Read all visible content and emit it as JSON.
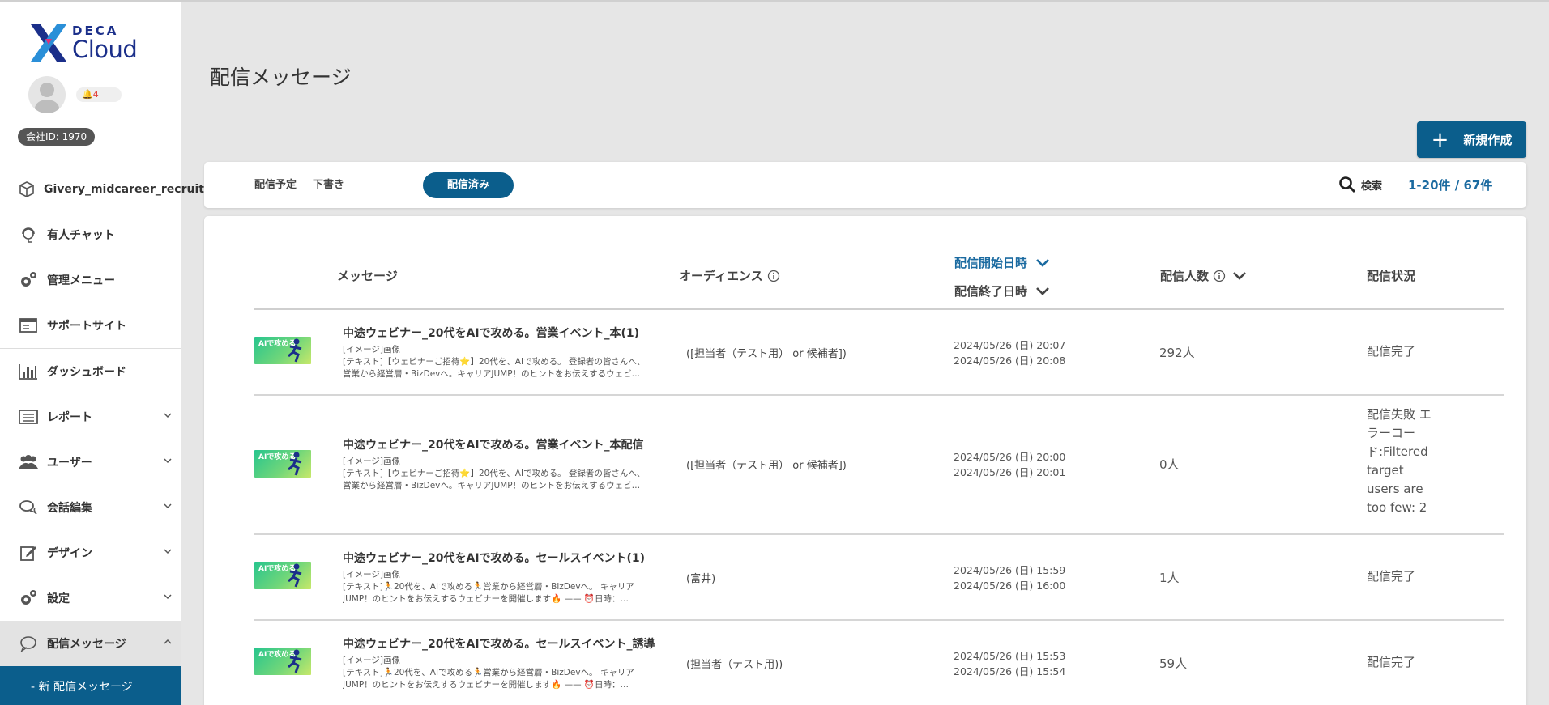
{
  "sidebar": {
    "logo_top": "DECA",
    "logo_bottom": "Cloud",
    "notification_count": "4",
    "company_id": "会社ID: 1970",
    "items": [
      {
        "label": "Givery_midcareer_recruit",
        "icon": "cube-icon"
      },
      {
        "label": "有人チャット",
        "icon": "headset-icon"
      },
      {
        "label": "管理メニュー",
        "icon": "gears-icon"
      },
      {
        "label": "サポートサイト",
        "icon": "browser-icon"
      },
      {
        "label": "ダッシュボード",
        "icon": "bar-chart-icon"
      },
      {
        "label": "レポート",
        "icon": "report-icon"
      },
      {
        "label": "ユーザー",
        "icon": "users-icon"
      },
      {
        "label": "会話編集",
        "icon": "chat-icon"
      },
      {
        "label": "デザイン",
        "icon": "edit-icon"
      },
      {
        "label": "設定",
        "icon": "gears-icon"
      },
      {
        "label": "配信メッセージ",
        "icon": "speech-bubble-icon"
      }
    ],
    "sub_item": "-  新 配信メッセージ"
  },
  "page": {
    "title": "配信メッセージ",
    "new_button": "新規作成"
  },
  "tabs": [
    {
      "label": "配信予定",
      "active": false
    },
    {
      "label": "下書き",
      "active": false
    },
    {
      "label": "配信済み",
      "active": true
    }
  ],
  "search_label": "検索",
  "pagination": "1-20件 / 67件",
  "table": {
    "headers": {
      "message": "メッセージ",
      "audience": "オーディエンス",
      "start": "配信開始日時",
      "end": "配信終了日時",
      "count": "配信人数",
      "status": "配信状況"
    },
    "rows": [
      {
        "title": "中途ウェビナー_20代をAIで攻める。営業イベント_本(1)",
        "line1": "[イメージ]画像",
        "line2": "[テキスト]【ウェビナーご招待⭐】20代を、AIで攻める。 登録者の皆さんへ、",
        "line3": "営業から経営層・BizDevへ。キャリアJUMP！のヒントをお伝えするウェビ…",
        "audience": "([担当者（テスト用） or 候補者])",
        "start": "2024/05/26 (日) 20:07",
        "end": "2024/05/26 (日) 20:08",
        "count": "292人",
        "status": "配信完了"
      },
      {
        "title": "中途ウェビナー_20代をAIで攻める。営業イベント_本配信",
        "line1": "[イメージ]画像",
        "line2": "[テキスト]【ウェビナーご招待⭐】20代を、AIで攻める。 登録者の皆さんへ、",
        "line3": "営業から経営層・BizDevへ。キャリアJUMP！のヒントをお伝えするウェビ…",
        "audience": "([担当者（テスト用） or 候補者])",
        "start": "2024/05/26 (日) 20:00",
        "end": "2024/05/26 (日) 20:01",
        "count": "0人",
        "status": "配信失敗 エラーコード:Filtered target users are too few: 2"
      },
      {
        "title": "中途ウェビナー_20代をAIで攻める。セールスイベント(1)",
        "line1": "[イメージ]画像",
        "line2": "[テキスト]🏃20代を、AIで攻める🏃営業から経営層・BizDevへ。 キャリア",
        "line3": "JUMP！のヒントをお伝えするウェビナーを開催します🔥 —— ⏰日時：…",
        "audience": "(富井)",
        "start": "2024/05/26 (日) 15:59",
        "end": "2024/05/26 (日) 16:00",
        "count": "1人",
        "status": "配信完了"
      },
      {
        "title": "中途ウェビナー_20代をAIで攻める。セールスイベント_誘導",
        "line1": "[イメージ]画像",
        "line2": "[テキスト]🏃20代を、AIで攻める🏃営業から経営層・BizDevへ。 キャリア",
        "line3": "JUMP！のヒントをお伝えするウェビナーを開催します🔥 —— ⏰日時：…",
        "audience": "(担当者（テスト用))",
        "start": "2024/05/26 (日) 15:53",
        "end": "2024/05/26 (日) 15:54",
        "count": "59人",
        "status": "配信完了"
      }
    ]
  },
  "thumb_text": "AIで攻める",
  "colors": {
    "primary": "#0b5e8c",
    "link": "#1a6aa0",
    "bell": "#e2443c"
  }
}
